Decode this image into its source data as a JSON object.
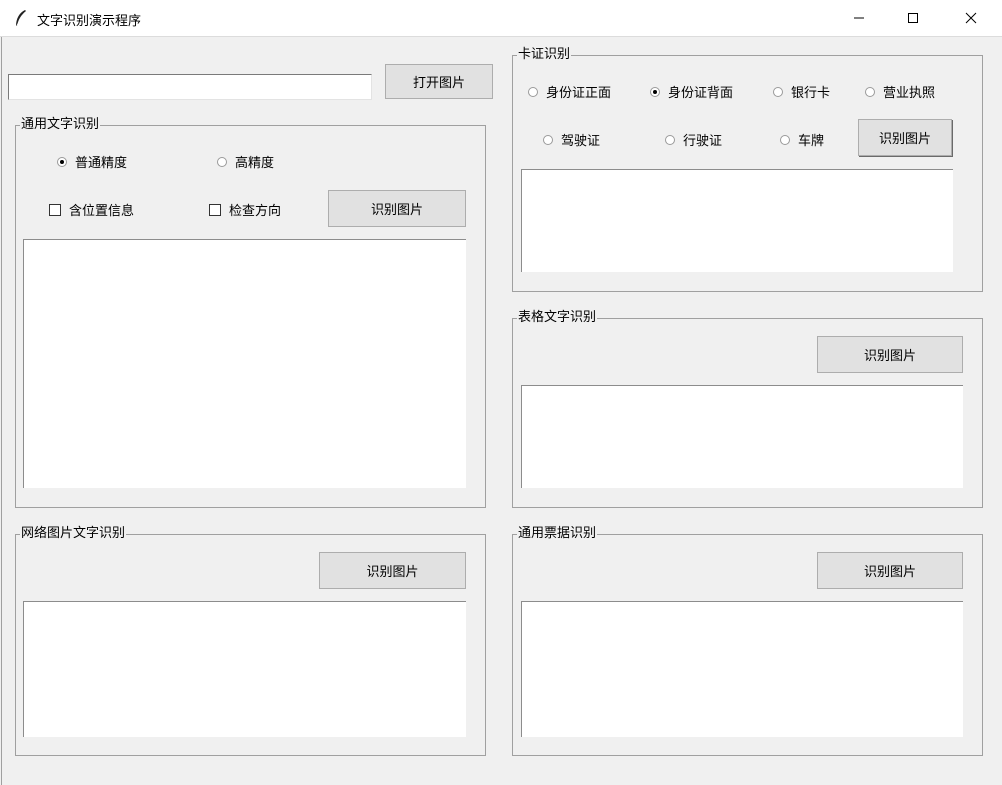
{
  "window": {
    "title": "文字识别演示程序",
    "icon": "feather-icon"
  },
  "top": {
    "path_value": "",
    "open_button": "打开图片"
  },
  "general": {
    "label": "通用文字识别",
    "radio_normal": "普通精度",
    "radio_high": "高精度",
    "selected": "普通精度",
    "check_location": "含位置信息",
    "check_direction": "检查方向",
    "recognize_button": "识别图片",
    "result": ""
  },
  "web_image": {
    "label": "网络图片文字识别",
    "recognize_button": "识别图片",
    "result": ""
  },
  "card": {
    "label": "卡证识别",
    "options": [
      "身份证正面",
      "身份证背面",
      "银行卡",
      "营业执照",
      "驾驶证",
      "行驶证",
      "车牌"
    ],
    "selected": "身份证背面",
    "recognize_button": "识别图片",
    "result": ""
  },
  "table": {
    "label": "表格文字识别",
    "recognize_button": "识别图片",
    "result": ""
  },
  "receipt": {
    "label": "通用票据识别",
    "recognize_button": "识别图片",
    "result": ""
  }
}
